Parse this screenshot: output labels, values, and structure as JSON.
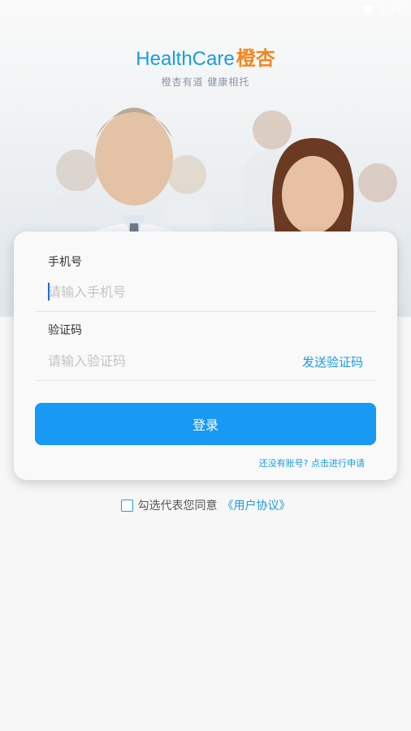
{
  "status_bar": {
    "time": "1:27"
  },
  "brand": {
    "name_en": "HealthCare",
    "name_cn": "橙杏",
    "tagline": "橙杏有道 健康相托"
  },
  "login": {
    "phone_label": "手机号",
    "phone_placeholder": "请输入手机号",
    "code_label": "验证码",
    "code_placeholder": "请输入验证码",
    "send_code": "发送验证码",
    "submit": "登录",
    "register_link": "还没有账号? 点击进行申请"
  },
  "agreement": {
    "text": "勾选代表您同意",
    "link": "《用户协议》"
  },
  "colors": {
    "accent": "#1899f3",
    "brand_orange": "#f3861c"
  }
}
